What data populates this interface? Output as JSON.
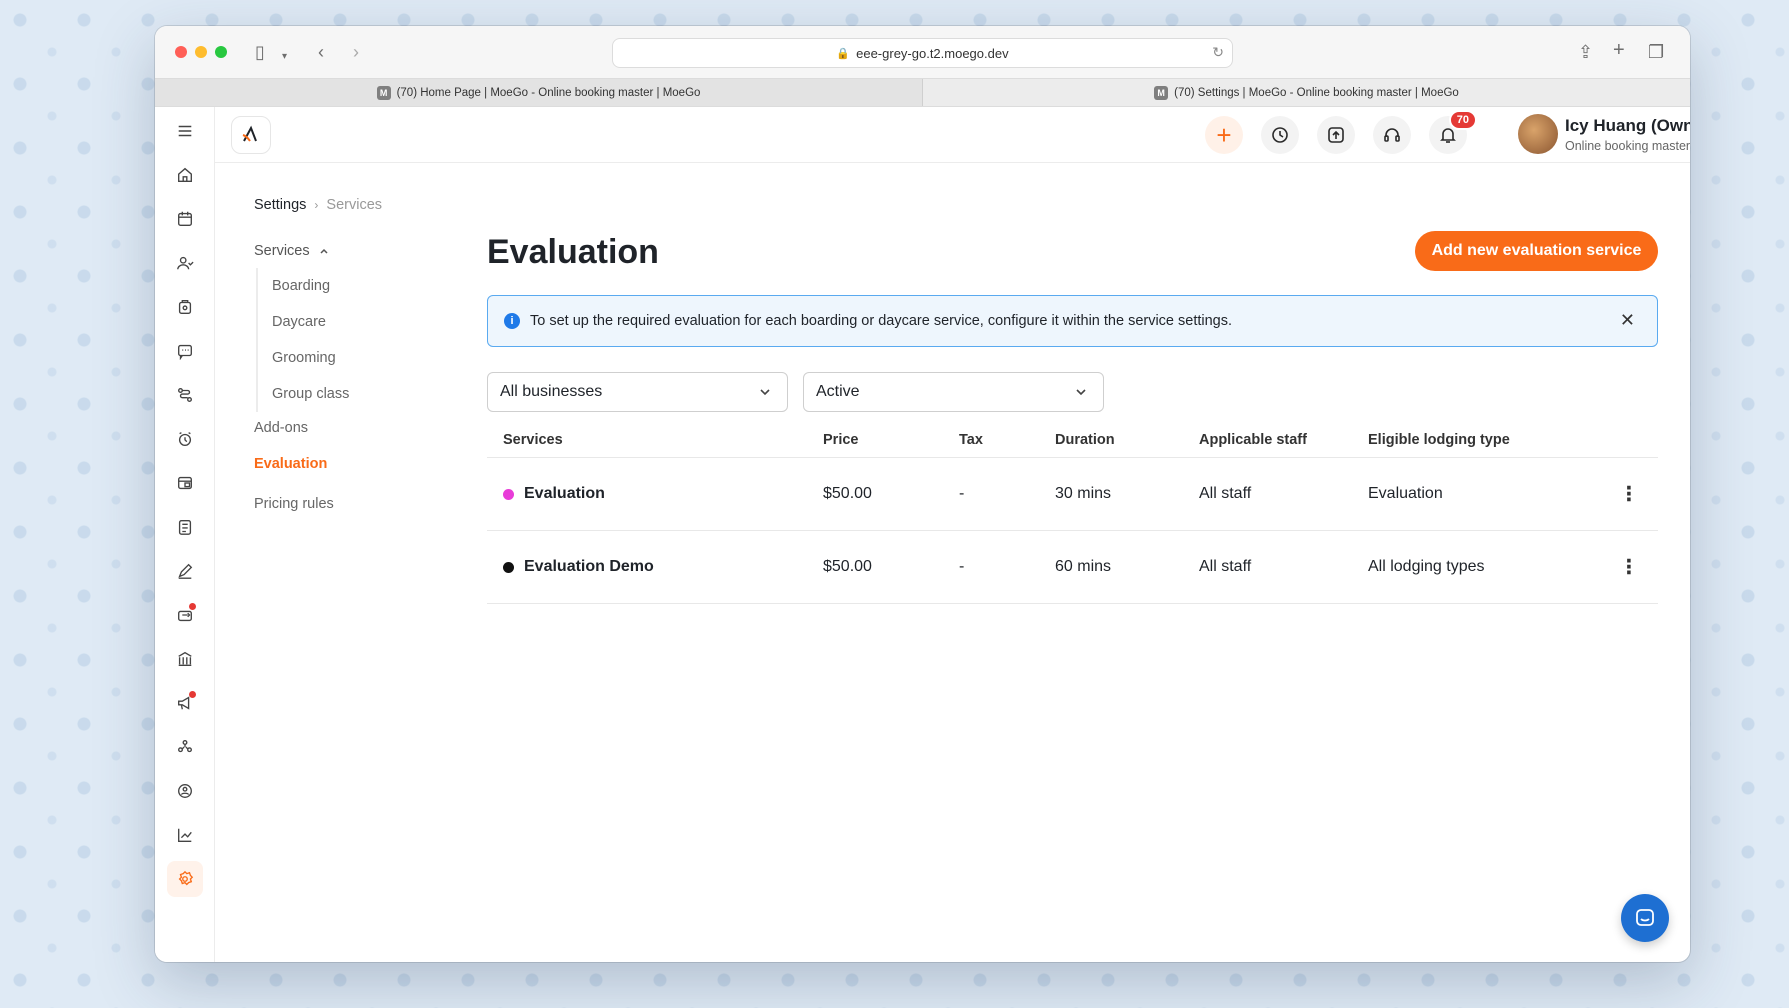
{
  "browser": {
    "url": "eee-grey-go.t2.moego.dev",
    "tabs": [
      {
        "label": "(70) Home Page | MoeGo - Online booking master | MoeGo",
        "active": false
      },
      {
        "label": "(70) Settings | MoeGo - Online booking master | MoeGo",
        "active": true
      }
    ],
    "favicon_letter": "M"
  },
  "rail": {
    "items": [
      "menu-icon",
      "home-icon",
      "calendar-icon",
      "clients-icon",
      "pets-icon",
      "messages-icon",
      "workflow-icon",
      "reminder-icon",
      "payments-icon",
      "tasks-icon",
      "edit-icon",
      "retail-icon",
      "business-icon",
      "marketing-icon",
      "community-icon",
      "membership-icon",
      "reports-icon",
      "settings-icon"
    ]
  },
  "header": {
    "notifications_count": "70",
    "user_name": "Icy Huang (Owner)",
    "user_subtitle": "Online booking master"
  },
  "breadcrumb": {
    "root": "Settings",
    "current": "Services"
  },
  "settings_nav": {
    "group_label": "Services",
    "sub_items": [
      "Boarding",
      "Daycare",
      "Grooming",
      "Group class"
    ],
    "items": [
      "Add-ons",
      "Evaluation",
      "Pricing rules"
    ],
    "active": "Evaluation"
  },
  "main": {
    "title": "Evaluation",
    "add_button": "Add new evaluation service",
    "info_banner": "To set up the required evaluation for each boarding or daycare service, configure it within the service settings.",
    "filters": {
      "business": "All businesses",
      "status": "Active"
    },
    "table": {
      "columns": [
        "Services",
        "Price",
        "Tax",
        "Duration",
        "Applicable staff",
        "Eligible lodging type"
      ],
      "rows": [
        {
          "color": "#e83cd8",
          "name": "Evaluation",
          "price": "$50.00",
          "tax": "-",
          "duration": "30 mins",
          "staff": "All staff",
          "lodging": "Evaluation"
        },
        {
          "color": "#111111",
          "name": "Evaluation Demo",
          "price": "$50.00",
          "tax": "-",
          "duration": "60 mins",
          "staff": "All staff",
          "lodging": "All lodging types"
        }
      ]
    }
  },
  "colors": {
    "accent": "#f96b18",
    "info_border": "#5aaaf0",
    "info_bg": "#eef6fd"
  }
}
